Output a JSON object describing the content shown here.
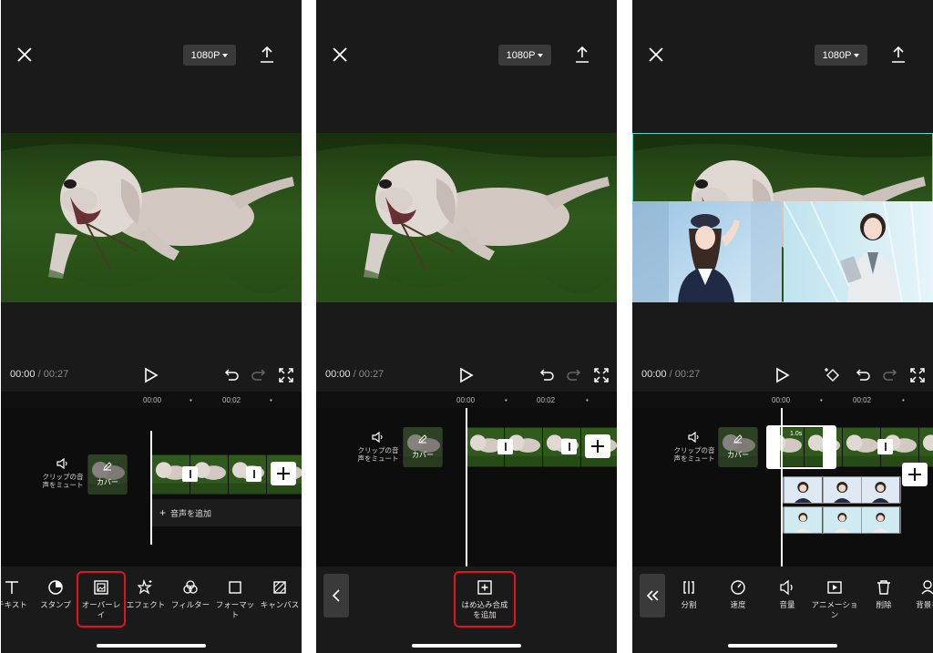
{
  "common": {
    "resolution": "1080P",
    "time_current": "00:00",
    "time_total": "00:27",
    "ruler": [
      "00:00",
      "00:02"
    ],
    "mute_label_line1": "クリップの音",
    "mute_label_line2": "声をミュート",
    "cover_label": "カバー"
  },
  "panel1": {
    "add_audio": "音声を追加",
    "tools": [
      {
        "label": "テキスト"
      },
      {
        "label": "スタンプ"
      },
      {
        "label_line1": "オーバーレ",
        "label_line2": "イ"
      },
      {
        "label": "エフェクト"
      },
      {
        "label": "フィルター"
      },
      {
        "label_line1": "フォーマッ",
        "label_line2": "ト"
      },
      {
        "label": "キャンバス"
      }
    ]
  },
  "panel2": {
    "pip_line1": "はめ込み合成",
    "pip_line2": "を追加"
  },
  "panel3": {
    "tools": [
      {
        "label": "分割"
      },
      {
        "label": "速度"
      },
      {
        "label": "音量"
      },
      {
        "label_line1": "アニメーショ",
        "label_line2": "ン"
      },
      {
        "label": "削除"
      },
      {
        "label": "背景を"
      }
    ],
    "clip_duration": "1.0s"
  },
  "colors": {
    "background": "#0f0f0f",
    "panel": "#1a1a1a",
    "highlight": "#e0141e",
    "selection": "#5fd3c6"
  }
}
